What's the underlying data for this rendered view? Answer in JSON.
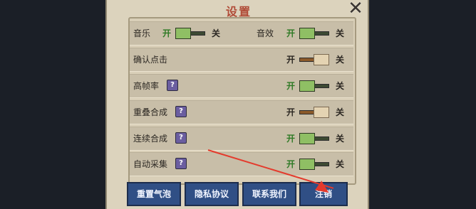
{
  "title": "设置",
  "close": "✕",
  "rows": [
    {
      "label": "音乐",
      "on": "开",
      "off": "关",
      "state": "on"
    },
    {
      "label": "音效",
      "on": "开",
      "off": "关",
      "state": "on"
    },
    {
      "label": "确认点击",
      "on": "开",
      "off": "关",
      "state": "off"
    },
    {
      "label": "高帧率",
      "on": "开",
      "off": "关",
      "state": "on"
    },
    {
      "label": "重叠合成",
      "on": "开",
      "off": "关",
      "state": "off"
    },
    {
      "label": "连续合成",
      "on": "开",
      "off": "关",
      "state": "on"
    },
    {
      "label": "自动采集",
      "on": "开",
      "off": "关",
      "state": "on"
    }
  ],
  "help_mark": "?",
  "buttons": {
    "reset_bubble": "重置气泡",
    "privacy": "隐私协议",
    "contact": "联系我们",
    "logout": "注销"
  }
}
